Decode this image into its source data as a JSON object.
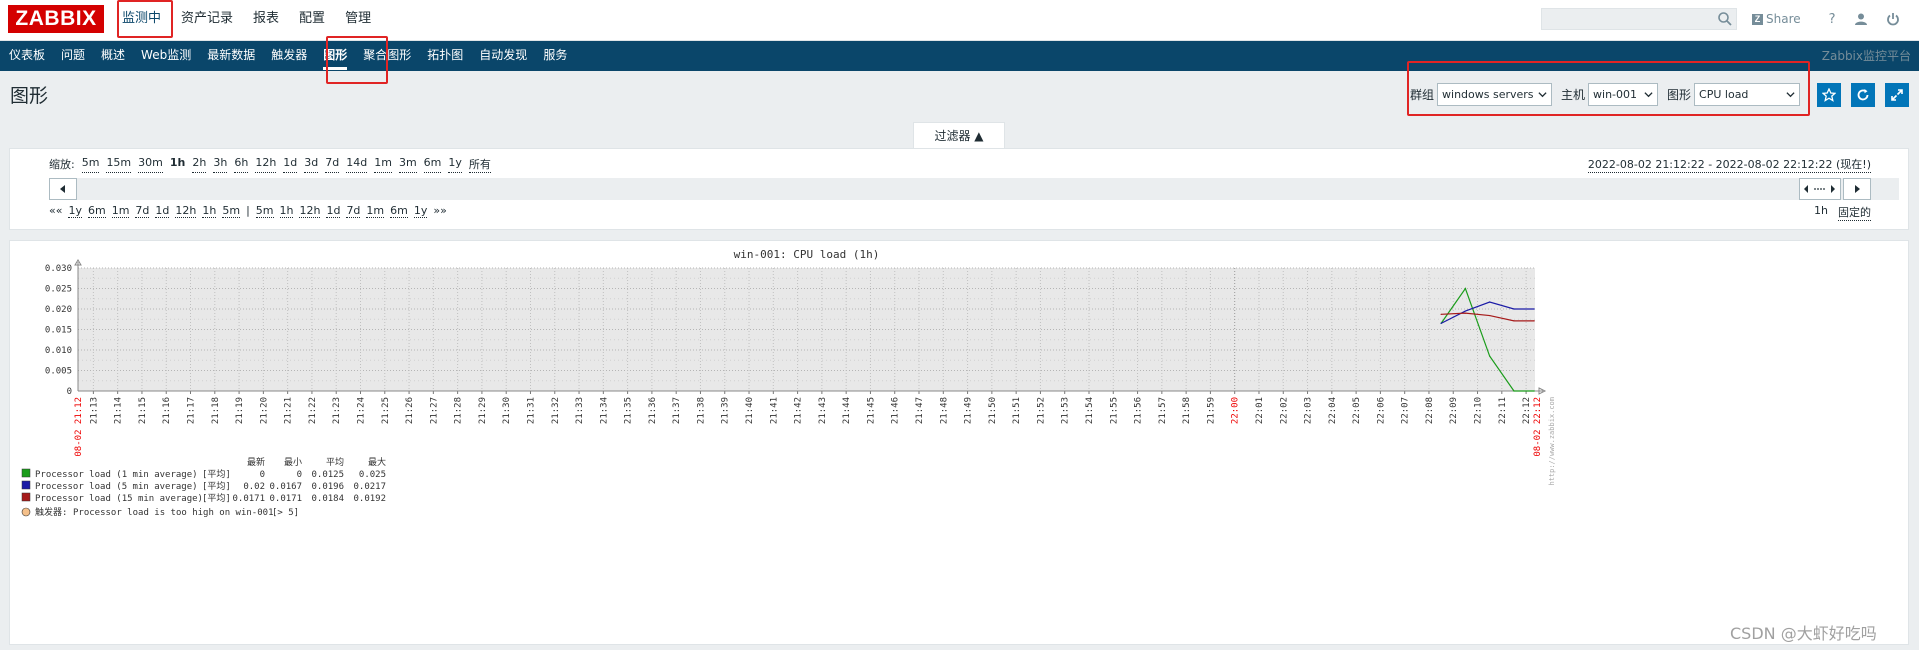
{
  "topbar": {
    "logo": "ZABBIX",
    "menu": [
      {
        "label": "监测中",
        "active": true
      },
      {
        "label": "资产记录",
        "active": false
      },
      {
        "label": "报表",
        "active": false
      },
      {
        "label": "配置",
        "active": false
      },
      {
        "label": "管理",
        "active": false
      }
    ],
    "share_label": "Share",
    "help_label": "?"
  },
  "subnav": {
    "items": [
      {
        "label": "仪表板",
        "active": false
      },
      {
        "label": "问题",
        "active": false
      },
      {
        "label": "概述",
        "active": false
      },
      {
        "label": "Web监测",
        "active": false
      },
      {
        "label": "最新数据",
        "active": false
      },
      {
        "label": "触发器",
        "active": false
      },
      {
        "label": "图形",
        "active": true
      },
      {
        "label": "聚合图形",
        "active": false
      },
      {
        "label": "拓扑图",
        "active": false
      },
      {
        "label": "自动发现",
        "active": false
      },
      {
        "label": "服务",
        "active": false
      }
    ],
    "platform": "Zabbix监控平台"
  },
  "header": {
    "title": "图形",
    "group_label": "群组",
    "group_value": "windows servers",
    "host_label": "主机",
    "host_value": "win-001",
    "graph_label": "图形",
    "graph_value": "CPU load"
  },
  "filter": {
    "tab_label": "过滤器 ▲",
    "zoom_label": "缩放:",
    "zoom_options": [
      "5m",
      "15m",
      "30m",
      "1h",
      "2h",
      "3h",
      "6h",
      "12h",
      "1d",
      "3d",
      "7d",
      "14d",
      "1m",
      "3m",
      "6m",
      "1y",
      "所有"
    ],
    "zoom_selected": "1h",
    "range_text": "2022-08-02 21:12:22 - 2022-08-02 22:12:22 (现在!)",
    "shift_row": [
      "««",
      "1y",
      "6m",
      "1m",
      "7d",
      "1d",
      "12h",
      "1h",
      "5m",
      "|",
      "5m",
      "1h",
      "12h",
      "1d",
      "7d",
      "1m",
      "6m",
      "1y",
      "»»"
    ],
    "period_label": "1h",
    "fixed_label": "固定的"
  },
  "chart_data": {
    "type": "line",
    "title": "win-001: CPU load (1h)",
    "ylim": [
      0,
      0.03
    ],
    "y_ticks": [
      "0.030",
      "0.025",
      "0.020",
      "0.015",
      "0.010",
      "0.005",
      "0"
    ],
    "x_ticks": [
      "21:13",
      "21:14",
      "21:15",
      "21:16",
      "21:17",
      "21:18",
      "21:19",
      "21:20",
      "21:21",
      "21:22",
      "21:23",
      "21:24",
      "21:25",
      "21:26",
      "21:27",
      "21:28",
      "21:29",
      "21:30",
      "21:31",
      "21:32",
      "21:33",
      "21:34",
      "21:35",
      "21:36",
      "21:37",
      "21:38",
      "21:39",
      "21:40",
      "21:41",
      "21:42",
      "21:43",
      "21:44",
      "21:45",
      "21:46",
      "21:47",
      "21:48",
      "21:49",
      "21:50",
      "21:51",
      "21:52",
      "21:53",
      "21:54",
      "21:55",
      "21:56",
      "21:57",
      "21:58",
      "21:59",
      "22:00",
      "22:01",
      "22:02",
      "22:03",
      "22:04",
      "22:05",
      "22:06",
      "22:07",
      "22:08",
      "22:09",
      "22:10",
      "22:11",
      "22:12"
    ],
    "x_start_label": "08-02 21:12",
    "x_end_label": "08-02 22:12",
    "watermark": "http://www.zabbix.com",
    "series": [
      {
        "name": "Processor load (1 min average)",
        "color": "#1a9c1a",
        "x": [
          "22:08:30",
          "22:09:30",
          "22:10:30",
          "22:11:30",
          "22:12:20"
        ],
        "values": [
          0.0165,
          0.025,
          0.0085,
          0.0,
          0.0
        ]
      },
      {
        "name": "Processor load (5 min average)",
        "color": "#1a1aa6",
        "x": [
          "22:08:30",
          "22:09:30",
          "22:10:30",
          "22:11:30",
          "22:12:20"
        ],
        "values": [
          0.0165,
          0.0195,
          0.0217,
          0.02,
          0.02
        ]
      },
      {
        "name": "Processor load (15 min average)",
        "color": "#a61a1a",
        "x": [
          "22:08:30",
          "22:09:30",
          "22:10:30",
          "22:11:30",
          "22:12:20"
        ],
        "values": [
          0.0187,
          0.019,
          0.0184,
          0.0171,
          0.0171
        ]
      }
    ],
    "legend": {
      "headers": [
        "最新",
        "最小",
        "平均",
        "最大"
      ],
      "func_label": "[平均]",
      "rows": [
        {
          "name": "Processor load (1 min average)",
          "color": "#1a9c1a",
          "last": "0",
          "min": "0",
          "avg": "0.0125",
          "max": "0.025"
        },
        {
          "name": "Processor load (5 min average)",
          "color": "#1a1aa6",
          "last": "0.02",
          "min": "0.0167",
          "avg": "0.0196",
          "max": "0.0217"
        },
        {
          "name": "Processor load (15 min average)",
          "color": "#a61a1a",
          "last": "0.0171",
          "min": "0.0171",
          "avg": "0.0184",
          "max": "0.0192"
        }
      ],
      "trigger_prefix": "触发器:",
      "trigger_text": "Processor load is too high on win-001",
      "trigger_threshold": "[> 5]"
    }
  },
  "watermark_text": "CSDN @大虾好吃吗"
}
